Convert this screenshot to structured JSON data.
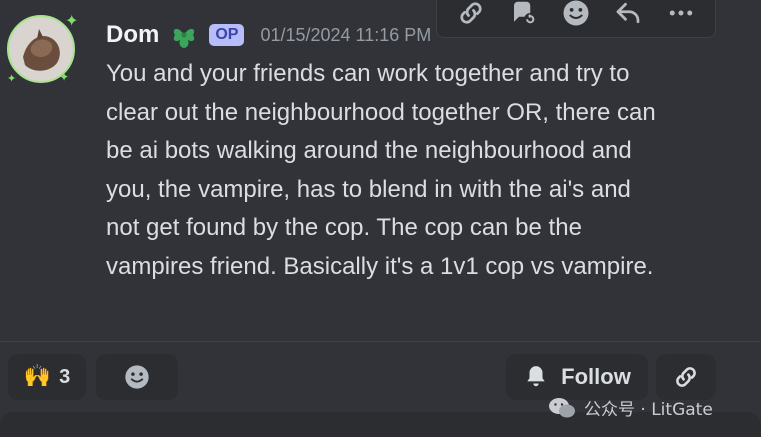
{
  "message": {
    "username": "Dom",
    "badge": "OP",
    "timestamp": "01/15/2024 11:16 PM",
    "text": "You and your friends can work together and try to clear out the neighbourhood together OR, there can be ai bots walking around the neighbourhood and you, the vampire, has to blend in with the ai's and not get found by the cop. The cop can be the vampires friend. Basically it's a 1v1 cop vs vampire."
  },
  "toolbar": {
    "icons": [
      "link-icon",
      "thread-icon",
      "emoji-icon",
      "reply-icon",
      "more-icon"
    ]
  },
  "footer": {
    "reaction_emoji": "🙌",
    "reaction_count": "3",
    "follow_label": "Follow"
  },
  "watermark": {
    "text": "公众号 · LitGate"
  },
  "colors": {
    "background": "#323339",
    "username": "#f2f3f5",
    "text": "#dbdee1",
    "timestamp": "#949ba4",
    "role_icon": "#3ba55c",
    "op_badge": "#b7bdfb",
    "pill": "#2b2d31"
  }
}
